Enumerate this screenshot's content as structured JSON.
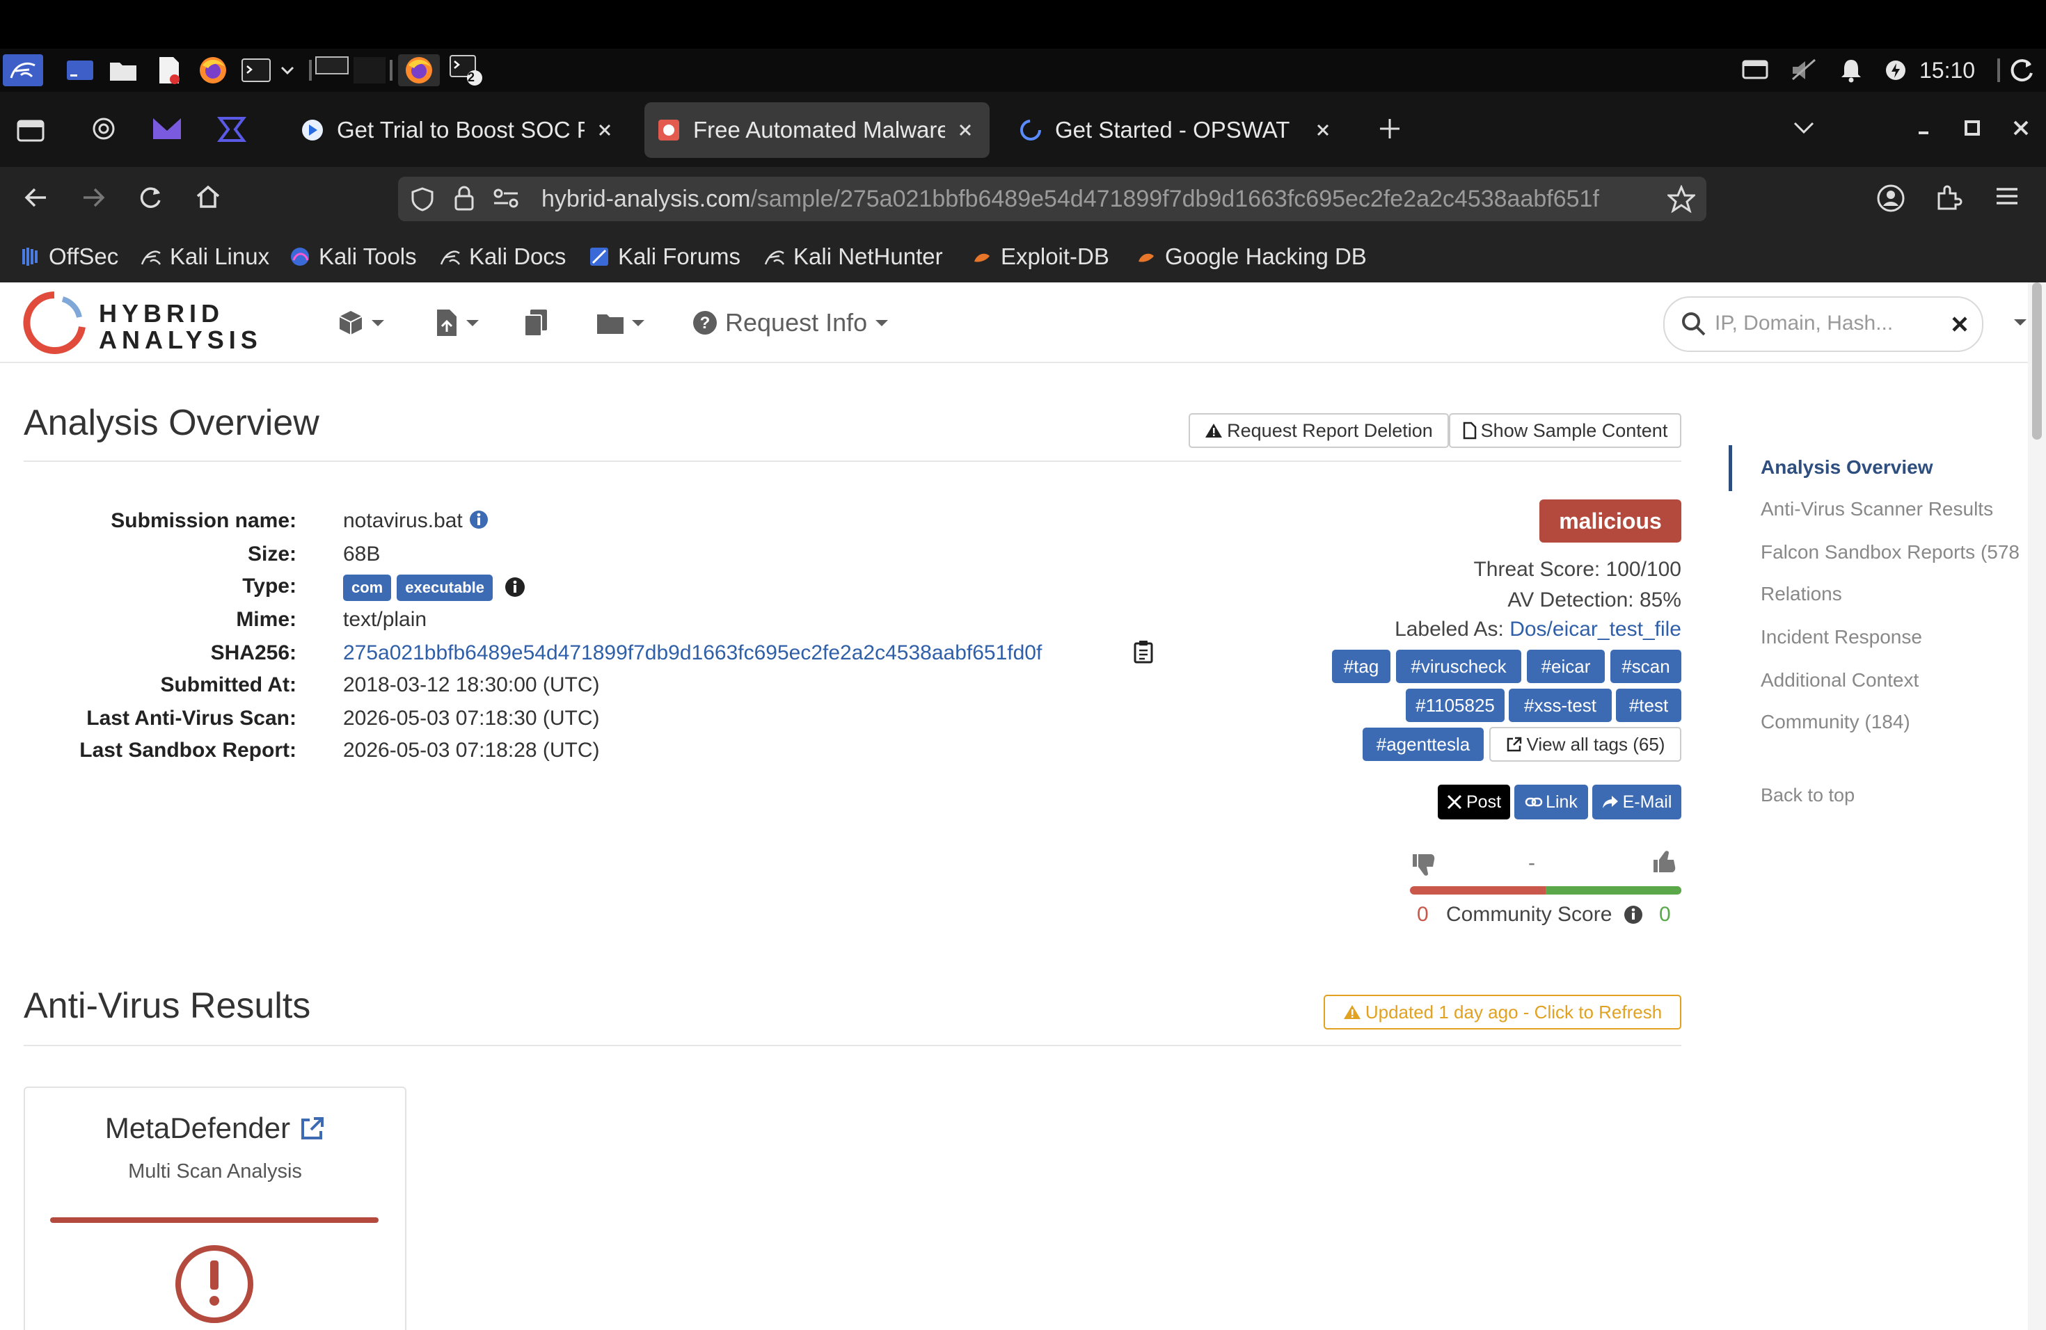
{
  "taskbar": {
    "clock": "15:10",
    "terminal_badge": "2"
  },
  "browser": {
    "tabs": [
      {
        "title": "Get Trial to Boost SOC Pe",
        "active": false
      },
      {
        "title": "Free Automated Malware",
        "active": true
      },
      {
        "title": "Get Started - OPSWAT",
        "active": false
      }
    ],
    "url_domain": "hybrid-analysis.com",
    "url_path": "/sample/275a021bbfb6489e54d471899f7db9d1663fc695ec2fe2a2c4538aabf651f",
    "bookmarks": [
      "OffSec",
      "Kali Linux",
      "Kali Tools",
      "Kali Docs",
      "Kali Forums",
      "Kali NetHunter",
      "Exploit-DB",
      "Google Hacking DB"
    ]
  },
  "site": {
    "logo_line1": "HYBRID",
    "logo_line2": "ANALYSIS",
    "request_info": "Request Info",
    "search_placeholder": "IP, Domain, Hash..."
  },
  "overview": {
    "title": "Analysis Overview",
    "request_deletion": "Request Report Deletion",
    "show_sample": "Show Sample Content",
    "labels": {
      "submission_name": "Submission name:",
      "size": "Size:",
      "type": "Type:",
      "mime": "Mime:",
      "sha256": "SHA256:",
      "submitted_at": "Submitted At:",
      "last_av_scan": "Last Anti-Virus Scan:",
      "last_sandbox": "Last Sandbox Report:"
    },
    "values": {
      "submission_name": "notavirus.bat",
      "size": "68B",
      "type_badges": [
        "com",
        "executable"
      ],
      "mime": "text/plain",
      "sha256": "275a021bbfb6489e54d471899f7db9d1663fc695ec2fe2a2c4538aabf651fd0f",
      "submitted_at": "2018-03-12 18:30:00 (UTC)",
      "last_av_scan": "2026-05-03 07:18:30 (UTC)",
      "last_sandbox": "2026-05-03 07:18:28 (UTC)"
    },
    "verdict": "malicious",
    "threat_score": "Threat Score: 100/100",
    "av_detection": "AV Detection: 85%",
    "labeled_as_prefix": "Labeled As:",
    "labeled_as_value": "Dos/eicar_test_file",
    "tags": [
      "#tag",
      "#viruscheck",
      "#eicar",
      "#scan",
      "#1105825",
      "#xss-test",
      "#test",
      "#agenttesla"
    ],
    "view_all_tags": "View all tags (65)",
    "share": {
      "post": "Post",
      "link": "Link",
      "email": "E-Mail"
    },
    "community": {
      "dash": "-",
      "down_count": "0",
      "up_count": "0",
      "label": "Community Score"
    }
  },
  "sidenav": [
    "Analysis Overview",
    "Anti-Virus Scanner Results",
    "Falcon Sandbox Reports (578",
    "Relations",
    "Incident Response",
    "Additional Context",
    "Community (184)",
    "Back to top"
  ],
  "av_results": {
    "title": "Anti-Virus Results",
    "refresh": "Updated 1 day ago - Click to Refresh",
    "card_title": "MetaDefender",
    "card_subtitle": "Multi Scan Analysis"
  },
  "colors": {
    "malicious": "#b44a3e",
    "tag_blue": "#3d6bb3",
    "link_blue": "#2f5fa8",
    "warning": "#e0a220",
    "score_green": "#5aa84a"
  }
}
